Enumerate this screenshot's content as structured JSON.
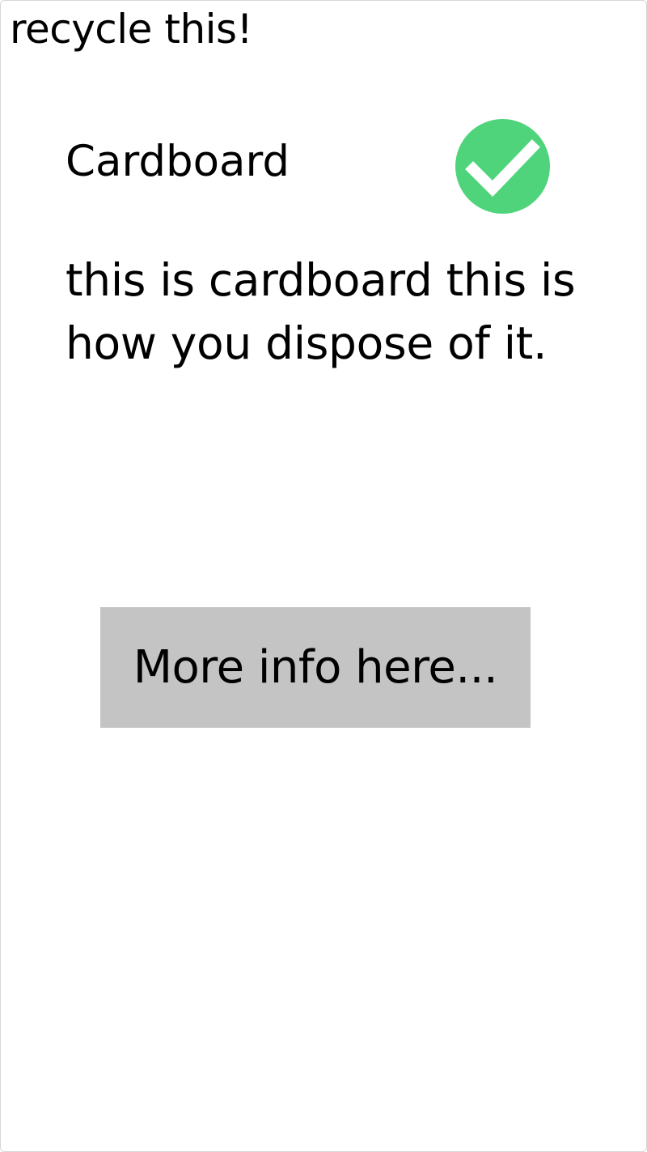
{
  "header": {
    "title": "recycle this!"
  },
  "item": {
    "name": "Cardboard",
    "status_icon": "check-circle-icon",
    "status_color": "#4fd47c",
    "description": "this is cardboard this is how you dispose of it."
  },
  "actions": {
    "more_info_label": "More info here...",
    "more_info_bg": "#c4c4c4"
  }
}
